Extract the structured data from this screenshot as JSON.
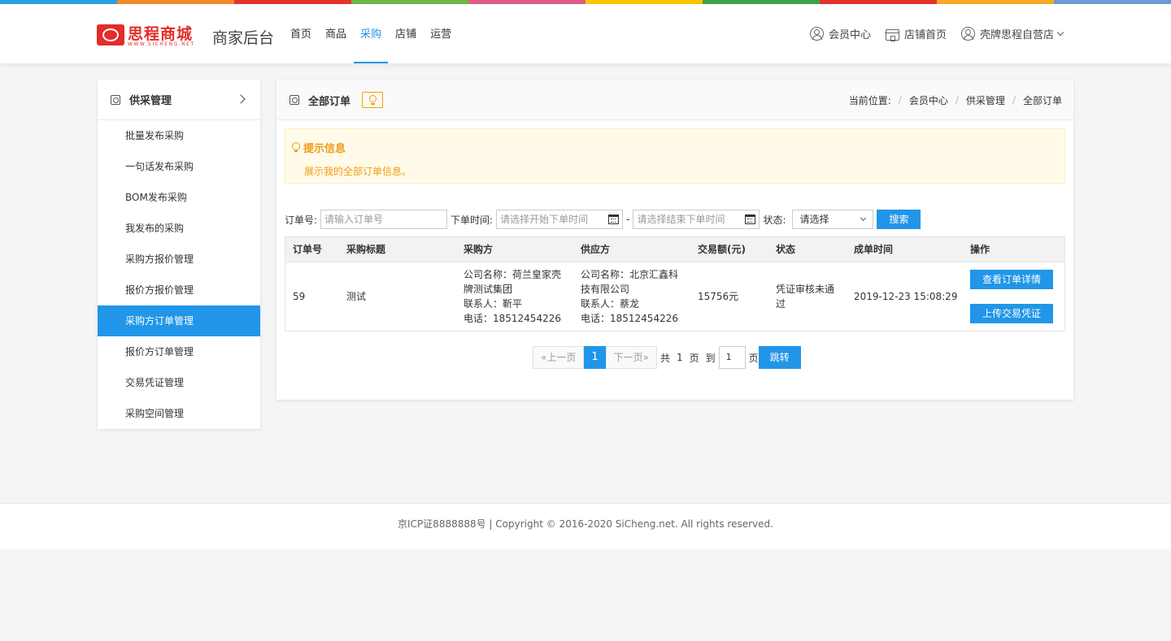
{
  "top_bar_colors": [
    "#2ba3dd",
    "#f08a2b",
    "#e5332d",
    "#6db842",
    "#e05d87",
    "#fcc600",
    "#3aa44b",
    "#e5332d",
    "#f7a928",
    "#6d9bd3"
  ],
  "header": {
    "logo_text": "思程商城",
    "logo_sub": "WWW.SICHENG.NET",
    "brand_name": "商家后台",
    "nav": [
      {
        "label": "首页"
      },
      {
        "label": "商品"
      },
      {
        "label": "采购"
      },
      {
        "label": "店铺"
      },
      {
        "label": "运营"
      }
    ],
    "active_nav": "采购",
    "member_center": "会员中心",
    "store_home": "店铺首页",
    "shop_name": "壳牌思程自营店"
  },
  "sidebar": {
    "title": "供采管理",
    "items": [
      {
        "label": "批量发布采购"
      },
      {
        "label": "一句话发布采购"
      },
      {
        "label": "BOM发布采购"
      },
      {
        "label": "我发布的采购"
      },
      {
        "label": "采购方报价管理"
      },
      {
        "label": "报价方报价管理"
      },
      {
        "label": "采购方订单管理"
      },
      {
        "label": "报价方订单管理"
      },
      {
        "label": "交易凭证管理"
      },
      {
        "label": "采购空间管理"
      }
    ],
    "active_item": "采购方订单管理"
  },
  "main": {
    "title": "全部订单",
    "breadcrumb": {
      "prefix": "当前位置:",
      "items": [
        "会员中心",
        "供采管理",
        "全部订单"
      ]
    },
    "tip": {
      "title": "提示信息",
      "text": "展示我的全部订单信息。"
    },
    "filter": {
      "order_no_label": "订单号:",
      "order_no_placeholder": "请输入订单号",
      "time_label": "下单时间:",
      "start_placeholder": "请选择开始下单时间",
      "dash": "-",
      "end_placeholder": "请选择结束下单时间",
      "status_label": "状态:",
      "status_value": "请选择",
      "search_label": "搜索"
    },
    "table": {
      "headers": [
        "订单号",
        "采购标题",
        "采购方",
        "供应方",
        "交易额(元)",
        "状态",
        "成单时间",
        "操作"
      ],
      "rows": [
        {
          "order_no": "59",
          "title": "测试",
          "buyer": {
            "line1": "公司名称：荷兰皇家壳",
            "line2": "牌测试集团",
            "contact": "联系人：靳平",
            "phone": "电话：18512454226"
          },
          "supplier": {
            "line1": "公司名称：北京汇鑫科",
            "line2": "技有限公司",
            "contact": "联系人：蔡龙",
            "phone": "电话：18512454226"
          },
          "amount": "15756元",
          "status_line1": "凭证审核未通",
          "status_line2": "过",
          "time": "2019-12-23 15:08:29",
          "action_view": "查看订单详情",
          "action_upload": "上传交易凭证"
        }
      ]
    },
    "pager": {
      "prev": "«上一页",
      "current": "1",
      "next": "下一页»",
      "total_prefix": "共",
      "total_pages": "1",
      "total_suffix": "页",
      "goto_prefix": "到",
      "goto_value": "1",
      "goto_suffix": "页",
      "goto_button": "跳转"
    }
  },
  "footer": {
    "text": "京ICP证8888888号 | Copyright © 2016-2020 SiCheng.net. All rights reserved."
  }
}
